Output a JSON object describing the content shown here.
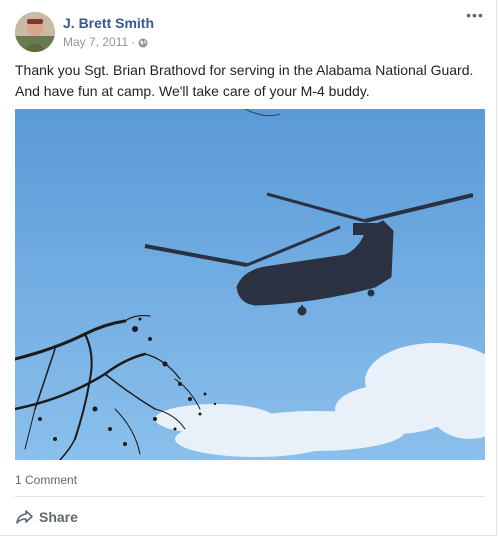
{
  "post": {
    "author": "J. Brett Smith",
    "date": "May 7, 2011",
    "separator": "·",
    "privacy_icon": "globe-icon",
    "more_label": "•••",
    "text": "Thank you Sgt. Brian Brathovd for serving in the Alabama National Guard. And have fun at camp. We'll take care of your M-4 buddy.",
    "photo_icon": "chinook-helicopter-photo"
  },
  "footer": {
    "comment_count": "1 Comment",
    "share_label": "Share",
    "share_icon": "share-arrow-icon"
  },
  "colors": {
    "author_link": "#365899",
    "meta_text": "#90949c",
    "sky_top": "#5a9ad8",
    "sky_bottom": "#8bc0ec"
  }
}
